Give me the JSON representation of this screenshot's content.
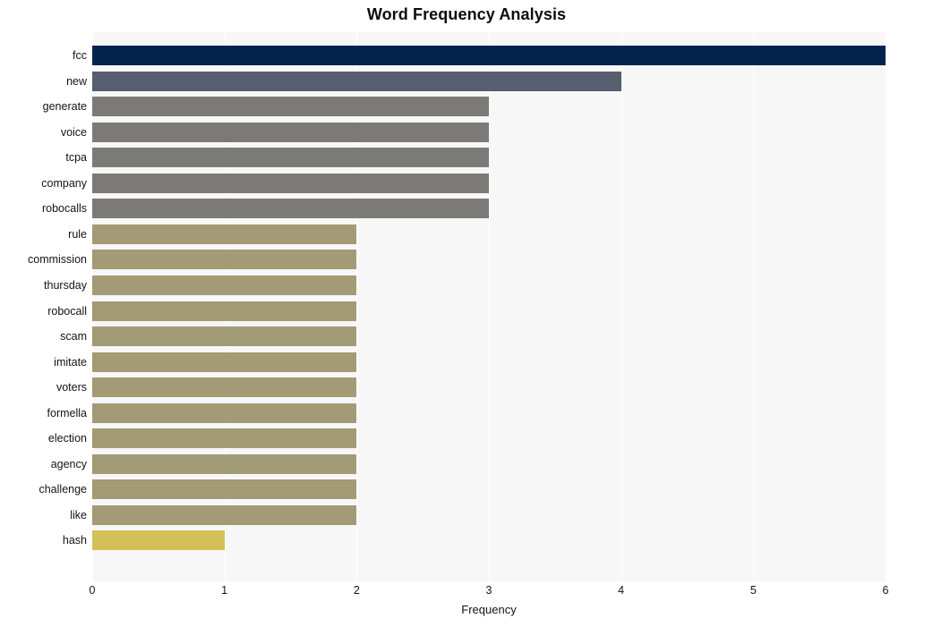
{
  "chart_data": {
    "type": "bar",
    "orientation": "horizontal",
    "title": "Word Frequency Analysis",
    "xlabel": "Frequency",
    "ylabel": "",
    "xlim": [
      0,
      6
    ],
    "ylim": [
      0,
      20
    ],
    "grid": true,
    "grid_axis": "x",
    "legend": false,
    "xticks": [
      "0",
      "1",
      "2",
      "3",
      "4",
      "5",
      "6"
    ],
    "xtick_values": [
      0,
      1,
      2,
      3,
      4,
      5,
      6
    ],
    "categories": [
      "fcc",
      "new",
      "generate",
      "voice",
      "tcpa",
      "company",
      "robocalls",
      "rule",
      "commission",
      "thursday",
      "robocall",
      "scam",
      "imitate",
      "voters",
      "formella",
      "election",
      "agency",
      "challenge",
      "like",
      "hash"
    ],
    "values": [
      6,
      4,
      3,
      3,
      3,
      3,
      3,
      2,
      2,
      2,
      2,
      2,
      2,
      2,
      2,
      2,
      2,
      2,
      2,
      1
    ],
    "bar_colors": [
      "#04244f",
      "#565e70",
      "#7b7a77",
      "#7b7a77",
      "#7b7a77",
      "#7b7a77",
      "#7b7a77",
      "#a39b76",
      "#a39b76",
      "#a39b76",
      "#a39b76",
      "#a39b76",
      "#a39b76",
      "#a39b76",
      "#a39b76",
      "#a39b76",
      "#a39b76",
      "#a39b76",
      "#a39b76",
      "#d3c157"
    ]
  },
  "style": {
    "plot_background": "#f7f7f7",
    "figure_background": "#ffffff",
    "gridline_color": "#ffffff",
    "text_color": "#131313",
    "title_color": "#0d0d0d"
  }
}
